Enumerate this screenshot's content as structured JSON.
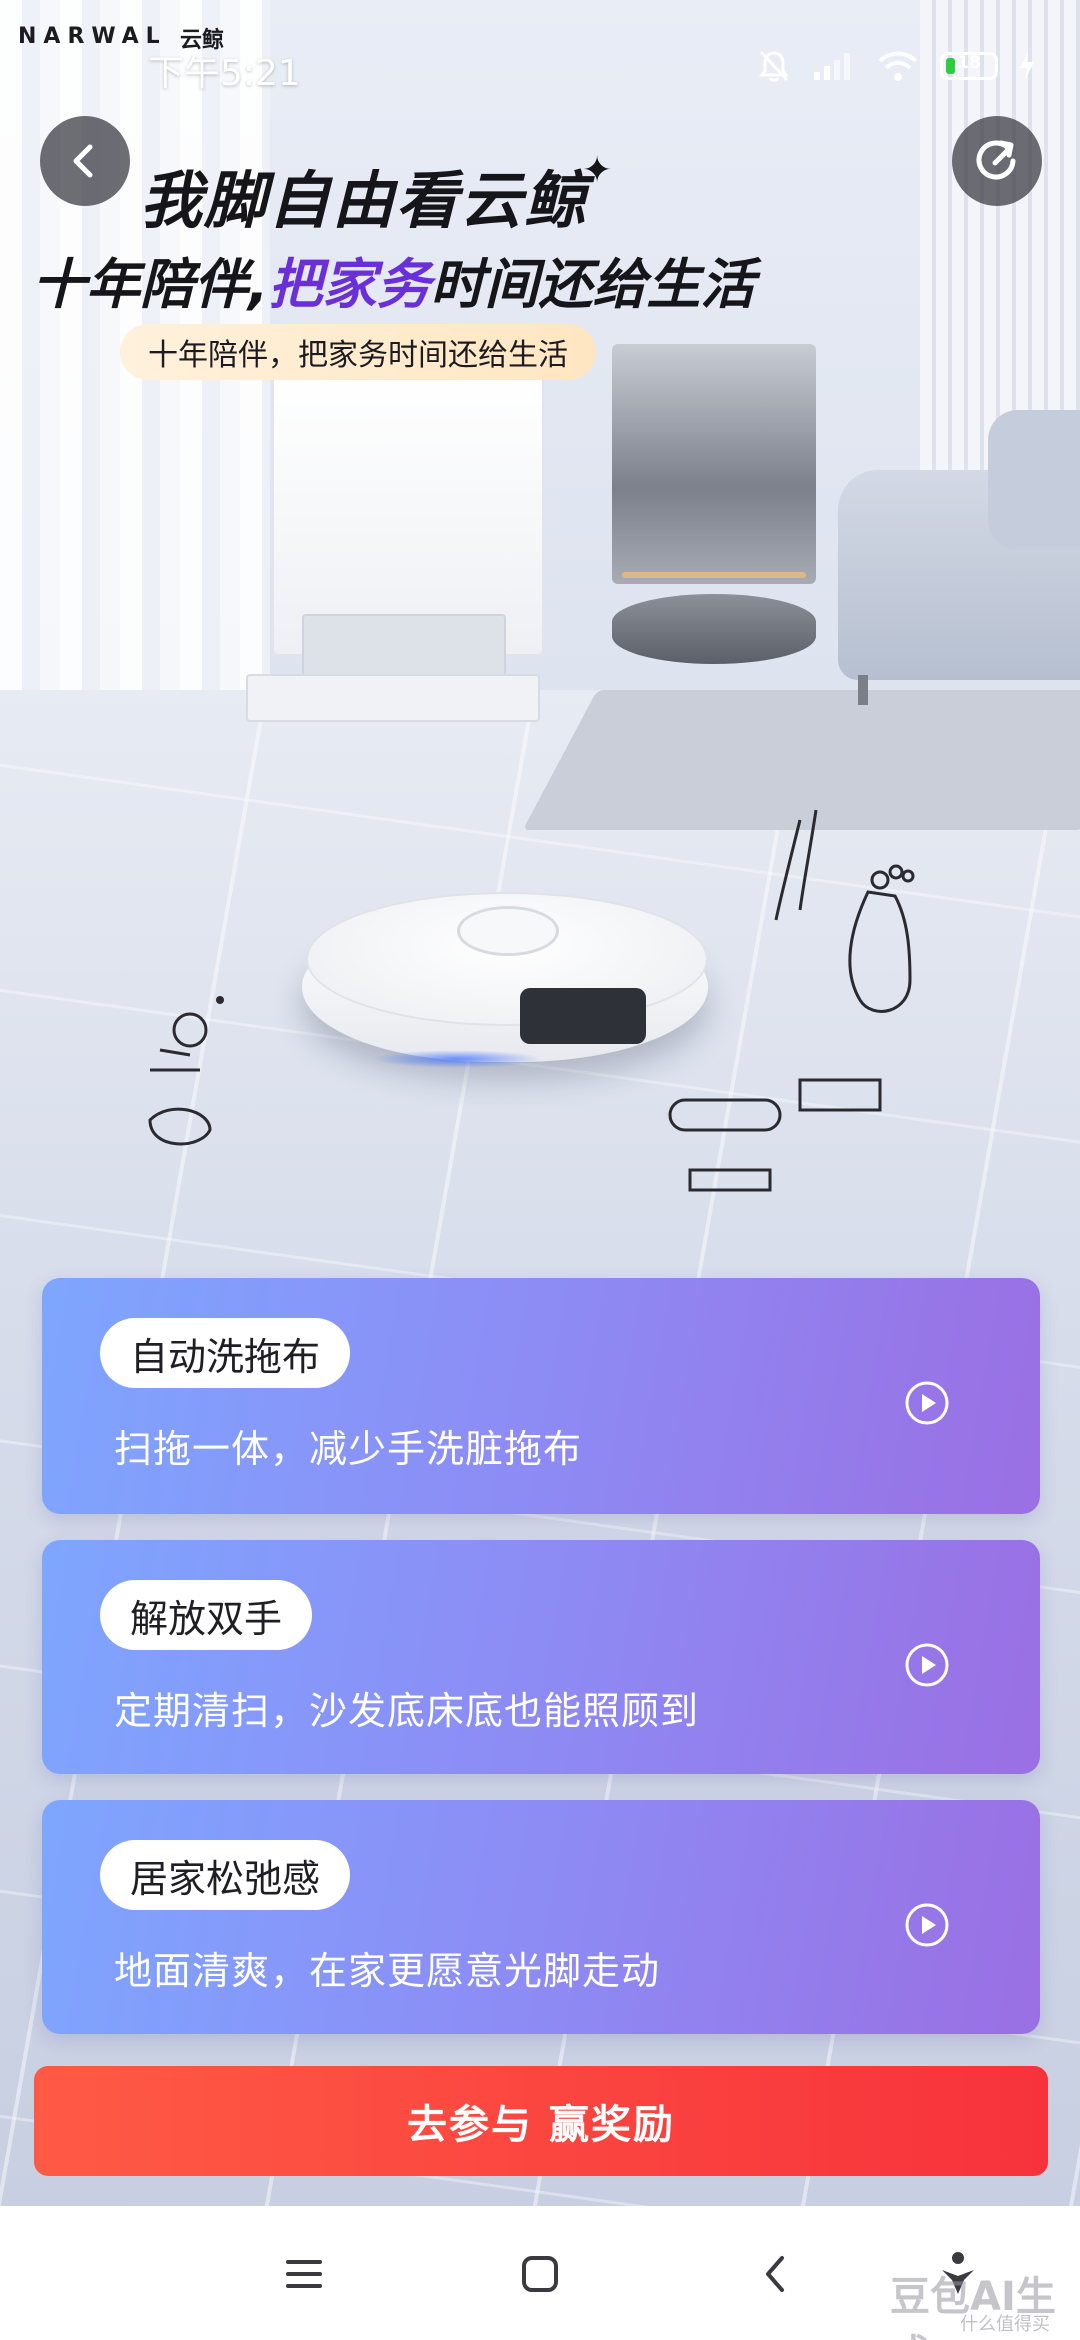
{
  "status_bar": {
    "brand": "NARWAL",
    "brand_cn": "云鲸",
    "time": "下午5:21",
    "battery_level": "18"
  },
  "nav": {
    "back_icon": "chevron-left-icon",
    "share_icon": "share-icon"
  },
  "hero": {
    "headline_line1": "我脚自由看云鲸",
    "headline_line2_prefix": "十年陪伴,",
    "headline_line2_accent": "把家务",
    "headline_line2_suffix": "时间还给生活",
    "sub_pill": "十年陪伴，把家务时间还给生活"
  },
  "features": [
    {
      "tag": "自动洗拖布",
      "desc": "扫拖一体，减少手洗脏拖布"
    },
    {
      "tag": "解放双手",
      "desc": "定期清扫，沙发底床底也能照顾到"
    },
    {
      "tag": "居家松弛感",
      "desc": "地面清爽，在家更愿意光脚走动"
    }
  ],
  "cta": {
    "label": "去参与 赢奖励"
  },
  "watermark": {
    "main": "豆包AI生成",
    "small": "什么值得买"
  },
  "colors": {
    "accent_purple": "#6a2fd8",
    "cta_red": "#f7323b",
    "card_blue": "#7ea6ff",
    "card_purple": "#9a6fe4"
  }
}
